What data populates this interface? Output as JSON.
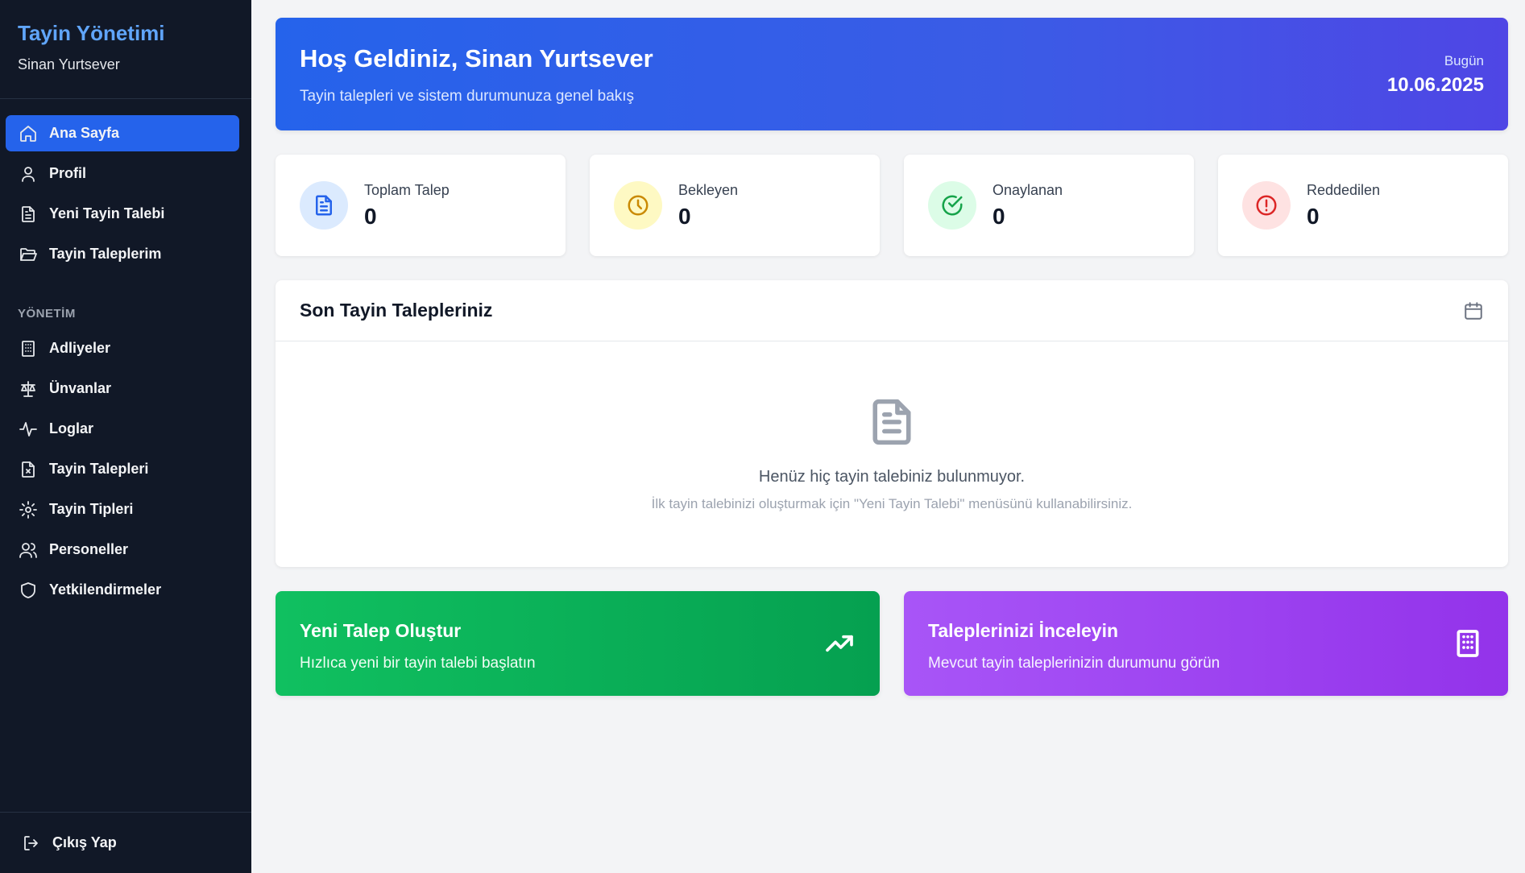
{
  "sidebar": {
    "app_title": "Tayin Yönetimi",
    "user_name": "Sinan Yurtsever",
    "items": [
      {
        "label": "Ana Sayfa",
        "icon": "home-icon",
        "active": true
      },
      {
        "label": "Profil",
        "icon": "user-icon"
      },
      {
        "label": "Yeni Tayin Talebi",
        "icon": "file-text-icon"
      },
      {
        "label": "Tayin Taleplerim",
        "icon": "folder-open-icon"
      }
    ],
    "section_label": "YÖNETİM",
    "admin_items": [
      {
        "label": "Adliyeler",
        "icon": "building-icon"
      },
      {
        "label": "Ünvanlar",
        "icon": "scale-icon"
      },
      {
        "label": "Loglar",
        "icon": "activity-icon"
      },
      {
        "label": "Tayin Talepleri",
        "icon": "file-x-icon"
      },
      {
        "label": "Tayin Tipleri",
        "icon": "gear-icon"
      },
      {
        "label": "Personeller",
        "icon": "users-icon"
      },
      {
        "label": "Yetkilendirmeler",
        "icon": "shield-icon"
      }
    ],
    "logout_label": "Çıkış Yap"
  },
  "hero": {
    "title": "Hoş Geldiniz, Sinan Yurtsever",
    "subtitle": "Tayin talepleri ve sistem durumunuza genel bakış",
    "date_label": "Bugün",
    "date": "10.06.2025"
  },
  "stats": [
    {
      "label": "Toplam Talep",
      "value": "0",
      "icon": "document-icon",
      "color": "#2563eb",
      "bg": "#dbeafe"
    },
    {
      "label": "Bekleyen",
      "value": "0",
      "icon": "clock-icon",
      "color": "#ca8a04",
      "bg": "#fef9c3"
    },
    {
      "label": "Onaylanan",
      "value": "0",
      "icon": "check-circle-icon",
      "color": "#16a34a",
      "bg": "#dcfce7"
    },
    {
      "label": "Reddedilen",
      "value": "0",
      "icon": "alert-circle-icon",
      "color": "#dc2626",
      "bg": "#fee2e2"
    }
  ],
  "recent": {
    "title": "Son Tayin Talepleriniz",
    "empty_message": "Henüz hiç tayin talebiniz bulunmuyor.",
    "empty_hint": "İlk tayin talebinizi oluşturmak için \"Yeni Tayin Talebi\" menüsünü kullanabilirsiniz."
  },
  "actions": [
    {
      "title": "Yeni Talep Oluştur",
      "subtitle": "Hızlıca yeni bir tayin talebi başlatın",
      "icon": "trending-up-icon"
    },
    {
      "title": "Taleplerinizi İnceleyin",
      "subtitle": "Mevcut tayin taleplerinizin durumunu görün",
      "icon": "building-icon"
    }
  ]
}
